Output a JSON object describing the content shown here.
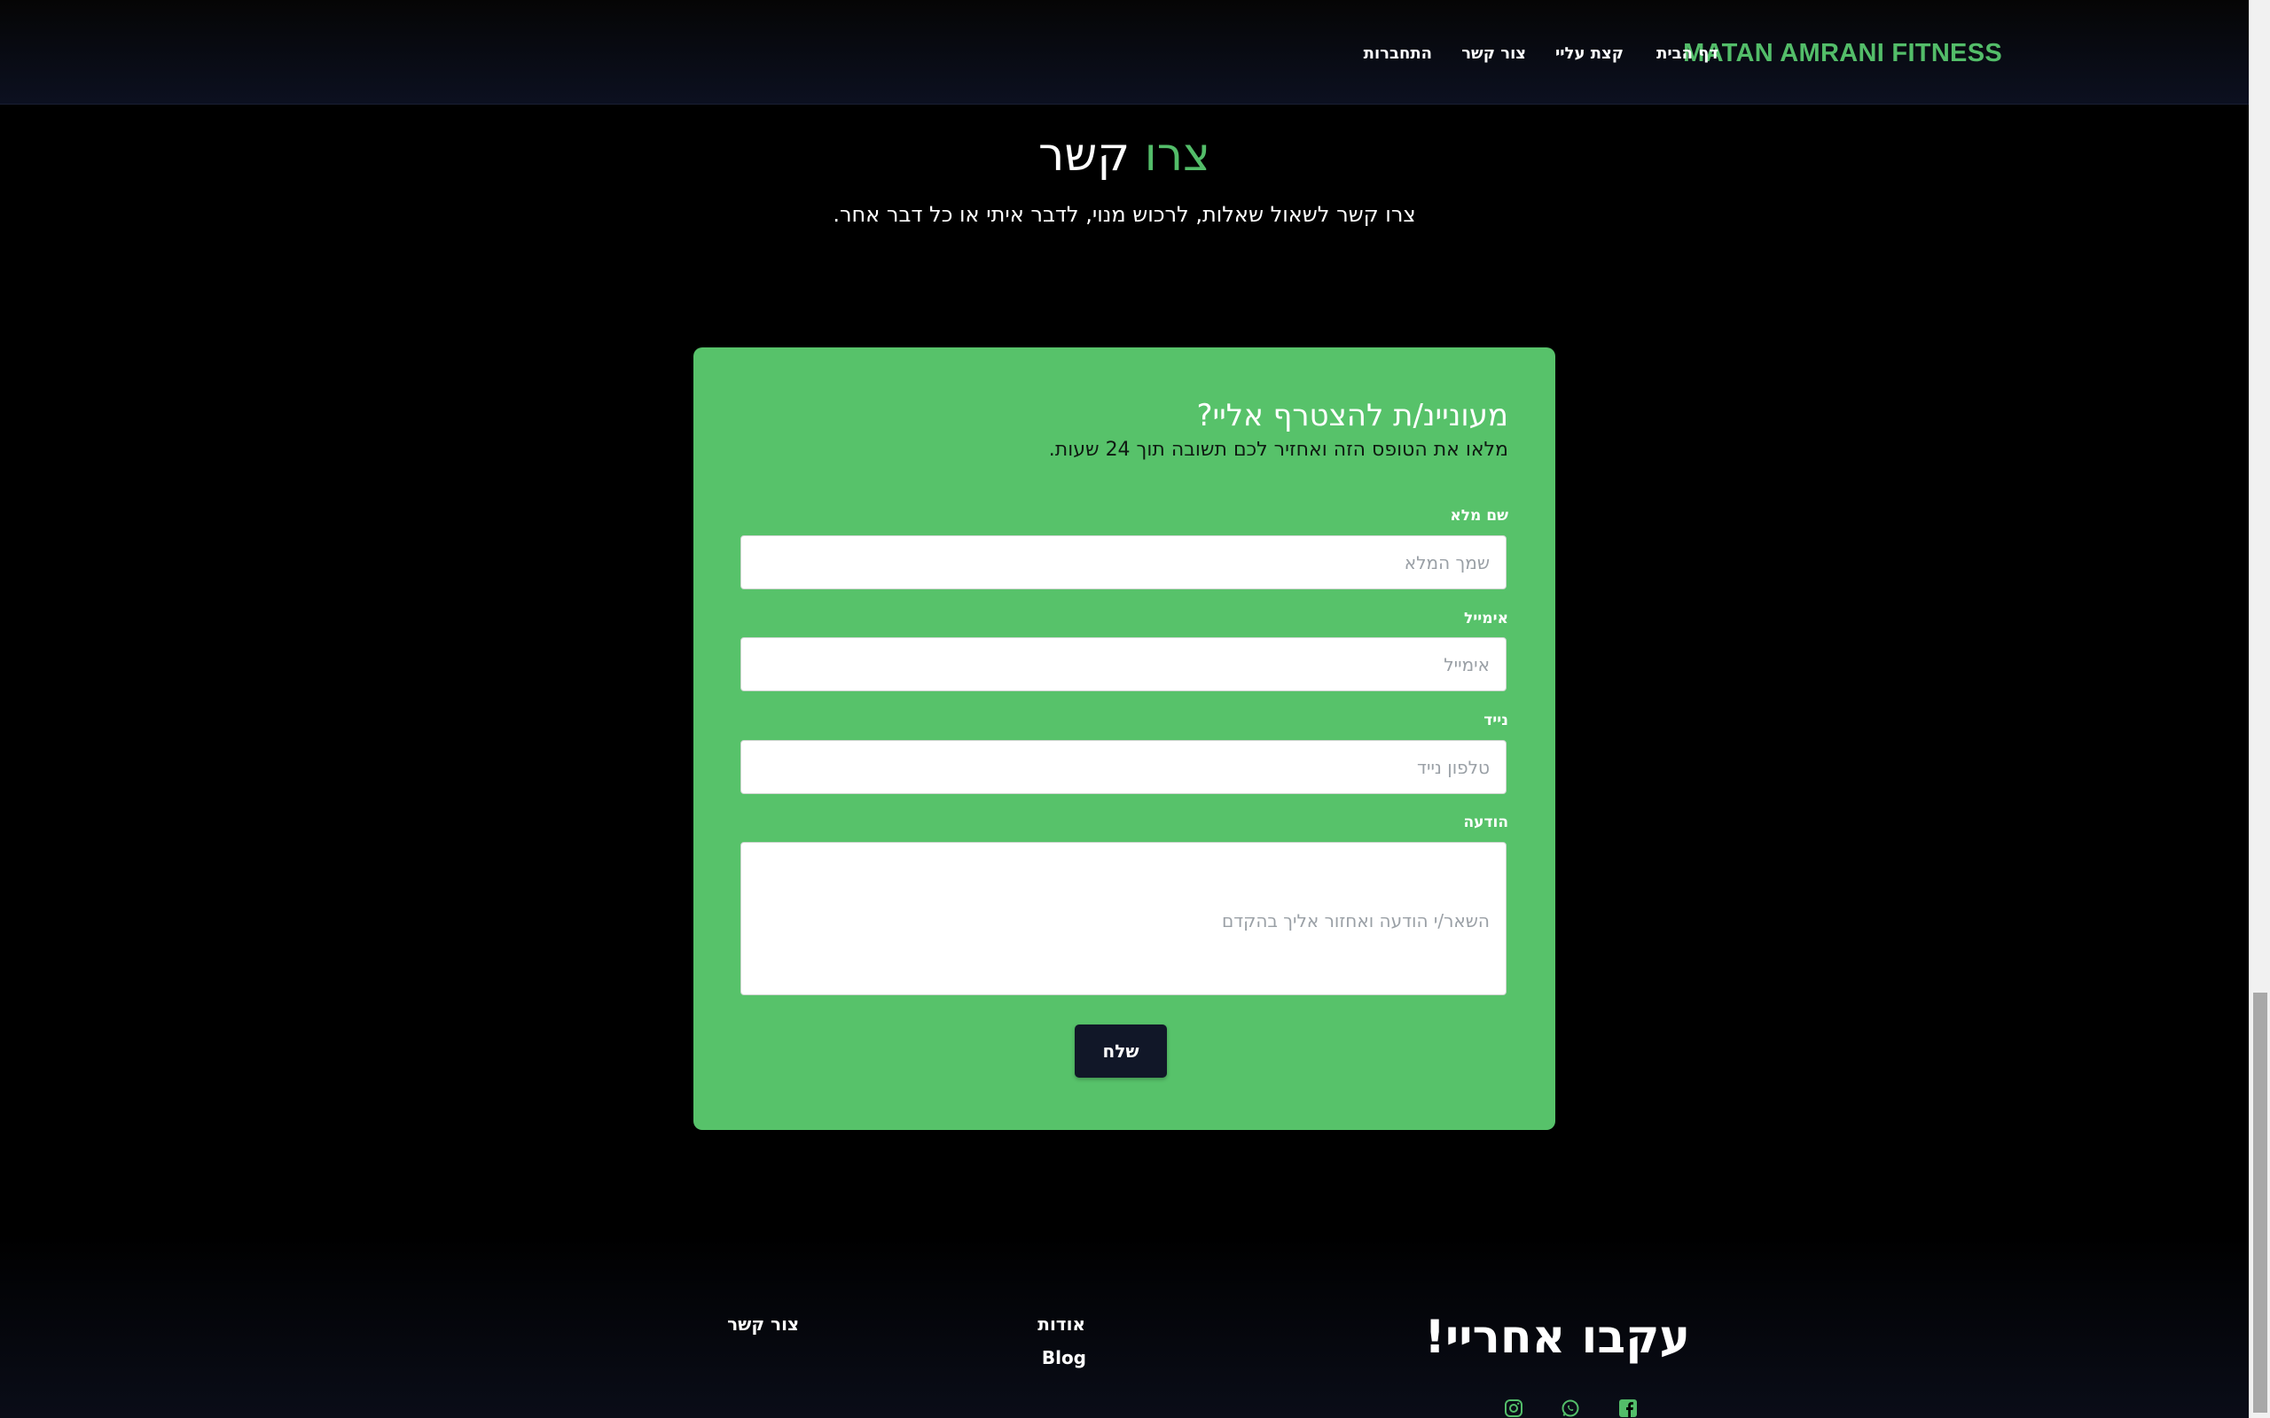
{
  "header": {
    "brand": "MATAN AMRANI FITNESS",
    "nav": {
      "home": "דף הבית",
      "about": "קצת עליי",
      "contact": "צור קשר",
      "login": "התחברות"
    }
  },
  "contact": {
    "title_accent": "צרו",
    "title_rest": "קשר",
    "subtitle": "צרו קשר לשאול שאלות, לרכוש מנוי, לדבר איתי או כל דבר אחר."
  },
  "form": {
    "title": "מעוניינ/ת להצטרף אליי?",
    "subtitle": "מלאו את הטופס הזה ואחזיר לכם תשובה תוך 24 שעות.",
    "name_label": "שם מלא",
    "name_placeholder": "שמך המלא",
    "email_label": "אימייל",
    "email_placeholder": "אימייל",
    "phone_label": "נייד",
    "phone_placeholder": "טלפון נייד",
    "message_label": "הודעה",
    "message_placeholder": "השאר/י הודעה ואחזור אליך בהקדם",
    "submit_label": "שלח"
  },
  "footer": {
    "follow_title": "עקבו אחריי!",
    "links": {
      "about": "אודות",
      "blog": "Blog",
      "contact": "צור קשר"
    },
    "social_icons": [
      "facebook-icon",
      "whatsapp-icon",
      "instagram-icon"
    ]
  },
  "colors": {
    "accent": "#53bd69",
    "card": "#57c26a",
    "button": "#111728"
  }
}
